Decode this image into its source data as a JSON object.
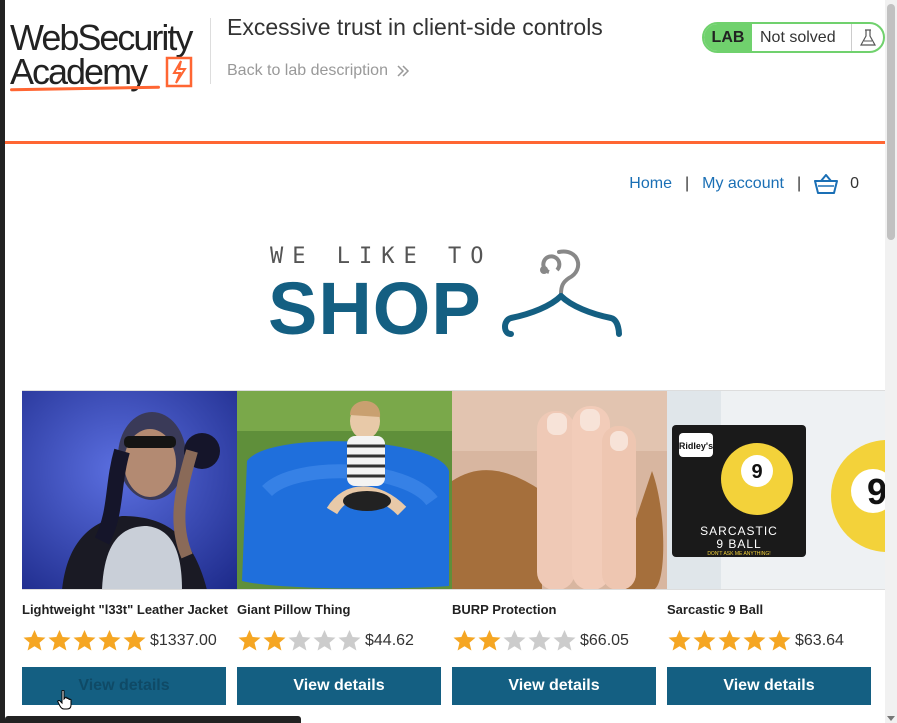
{
  "header": {
    "logo_line1": "WebSecurity",
    "logo_line2": "Academy",
    "lab_title": "Excessive trust in client-side controls",
    "back_link": "Back to lab description",
    "status_badge": "LAB",
    "status_text": "Not solved"
  },
  "nav": {
    "home": "Home",
    "my_account": "My account",
    "separator": "|",
    "cart_count": "0"
  },
  "hero": {
    "tagline": "WE LIKE TO",
    "shop": "SHOP"
  },
  "products": [
    {
      "name": "Lightweight \"l33t\" Leather Jacket",
      "rating": 5,
      "price": "$1337.00",
      "button": "View details"
    },
    {
      "name": "Giant Pillow Thing",
      "rating": 2,
      "price": "$44.62",
      "button": "View details"
    },
    {
      "name": "BURP Protection",
      "rating": 2,
      "price": "$66.05",
      "button": "View details"
    },
    {
      "name": "Sarcastic 9 Ball",
      "rating": 5,
      "price": "$63.64",
      "button": "View details"
    }
  ],
  "product_images": {
    "ball_brand": "Ridley's",
    "ball_title_line1": "SARCASTIC",
    "ball_title_line2": "9 BALL",
    "ball_subtitle": "DON'T ASK ME ANYTHING!",
    "ball_number": "9"
  },
  "colors": {
    "accent_orange": "#ff6633",
    "brand_blue": "#145f82",
    "link_blue": "#1a6fb5",
    "status_green": "#70d16d",
    "star_gold": "#f5a623",
    "star_empty": "#cccccc"
  }
}
